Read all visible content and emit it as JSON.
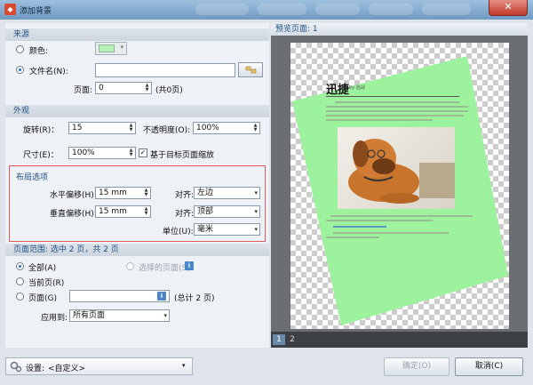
{
  "window": {
    "title": "添加背景",
    "close_label": "✕"
  },
  "source": {
    "header": "来源",
    "color_label": "颜色:",
    "color_value": "#b7f0b7",
    "file_label": "文件名(N):",
    "file_value": "",
    "page_label": "页面:",
    "page_value": "0",
    "page_total": "(共0页)"
  },
  "appearance": {
    "header": "外观",
    "rotation_label": "旋转(R)：",
    "rotation_value": "15",
    "opacity_label": "不透明度(O):",
    "opacity_value": "100%",
    "size_label": "尺寸(E)：",
    "size_value": "100%",
    "scale_label": "基于目标页面缩放",
    "scale_checked": "✓"
  },
  "layout": {
    "header": "布局选项",
    "hoffset_label": "水平偏移(H):",
    "hoffset_value": "15 mm",
    "voffset_label": "垂直偏移(H):",
    "voffset_value": "15 mm",
    "align_label": "对齐:",
    "halign_value": "左边",
    "valign_value": "顶部",
    "unit_label": "单位(U):",
    "unit_value": "毫米"
  },
  "page_range": {
    "header": "页面范围: 选中 2 页，共 2 页",
    "all_label": "全部(A)",
    "selected_label": "选择的页面(S)",
    "current_label": "当前页(R)",
    "pages_label": "页面(G)",
    "pages_value": "",
    "pages_total": "(总计 2 页)",
    "apply_label": "应用到:",
    "apply_value": "所有页面"
  },
  "preview": {
    "header": "预览页面: 1",
    "doc_title": "迅捷",
    "doc_subtitle": "by 陆战",
    "thumbs": [
      "1",
      "2"
    ],
    "colors": {
      "overlay": "#9df39d"
    }
  },
  "footer": {
    "settings_label": "设置:",
    "settings_value": "<自定义>",
    "ok_label": "确定(O)",
    "cancel_label": "取消(C)"
  }
}
